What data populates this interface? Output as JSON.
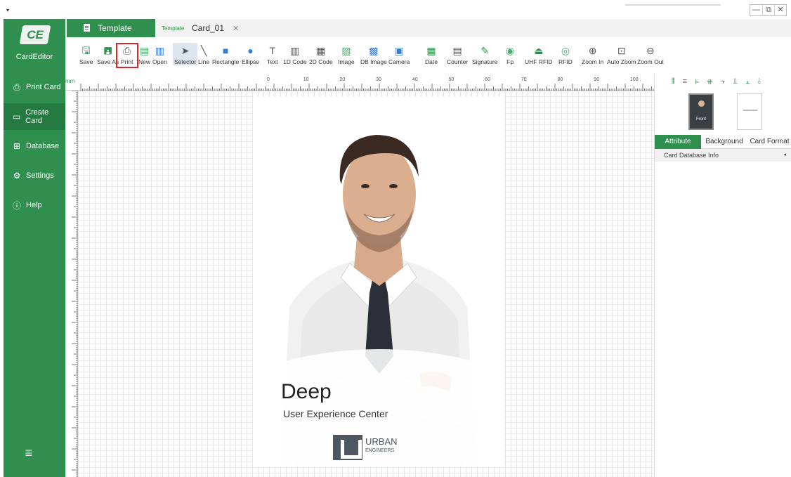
{
  "window": {
    "menu_caret": "▾",
    "controls": [
      "—",
      "⧉",
      "✕"
    ]
  },
  "sidebar": {
    "logo": "CE",
    "brand": "CardEditor",
    "items": [
      {
        "label": "Print Card",
        "icon": "printer-icon"
      },
      {
        "label": "Create Card",
        "icon": "card-icon",
        "active": true
      },
      {
        "label": "Database",
        "icon": "table-icon"
      },
      {
        "label": "Settings",
        "icon": "gear-icon"
      },
      {
        "label": "Help",
        "icon": "help-icon"
      }
    ],
    "collapse_icon": "≣"
  },
  "tabs": {
    "template_tab": "Template",
    "template_tag": "Template",
    "card_tab": "Card_01",
    "close_glyph": "✕"
  },
  "toolbar": {
    "items": [
      {
        "label": "Save",
        "icon": "save-icon"
      },
      {
        "label": "Save As",
        "icon": "save-as-icon"
      },
      {
        "label": "Print",
        "icon": "printer-icon"
      },
      {
        "label": "New",
        "icon": "new-icon"
      },
      {
        "label": "Open",
        "icon": "open-icon"
      },
      {
        "label": "Selector",
        "icon": "cursor-icon"
      },
      {
        "label": "Line",
        "icon": "line-icon"
      },
      {
        "label": "Rectangle",
        "icon": "rectangle-icon"
      },
      {
        "label": "Ellipse",
        "icon": "ellipse-icon"
      },
      {
        "label": "Text",
        "icon": "text-icon"
      },
      {
        "label": "1D Code",
        "icon": "barcode-icon"
      },
      {
        "label": "2D Code",
        "icon": "qrcode-icon"
      },
      {
        "label": "Image",
        "icon": "image-icon"
      },
      {
        "label": "DB Image",
        "icon": "db-image-icon"
      },
      {
        "label": "Camera",
        "icon": "camera-icon"
      },
      {
        "label": "Date",
        "icon": "calendar-icon"
      },
      {
        "label": "Counter",
        "icon": "counter-icon"
      },
      {
        "label": "Signature",
        "icon": "pen-icon"
      },
      {
        "label": "Fp",
        "icon": "fingerprint-icon"
      },
      {
        "label": "UHF RFID",
        "icon": "uhf-rfid-icon"
      },
      {
        "label": "RFID",
        "icon": "rfid-icon"
      },
      {
        "label": "Zoom In",
        "icon": "zoom-in-icon"
      },
      {
        "label": "Auto Zoom",
        "icon": "auto-zoom-icon"
      },
      {
        "label": "Zoom Out",
        "icon": "zoom-out-icon"
      }
    ]
  },
  "ruler": {
    "unit": "mm",
    "top_marks": [
      "0",
      "10",
      "20",
      "30",
      "40",
      "50",
      "60",
      "70",
      "80",
      "90",
      "100"
    ]
  },
  "card": {
    "name": "Deep",
    "subtitle": "User Experience Center",
    "logo_line1": "URBAN",
    "logo_line2": "ENGINEERS"
  },
  "right_panel": {
    "front_label": "Front",
    "tabs": [
      "Attribute",
      "Background",
      "Card Format"
    ],
    "section": "Card Database Info",
    "section_arrow": "◂"
  },
  "colors": {
    "brand_green": "#2f8f4e",
    "highlight_red": "#d9262c"
  }
}
